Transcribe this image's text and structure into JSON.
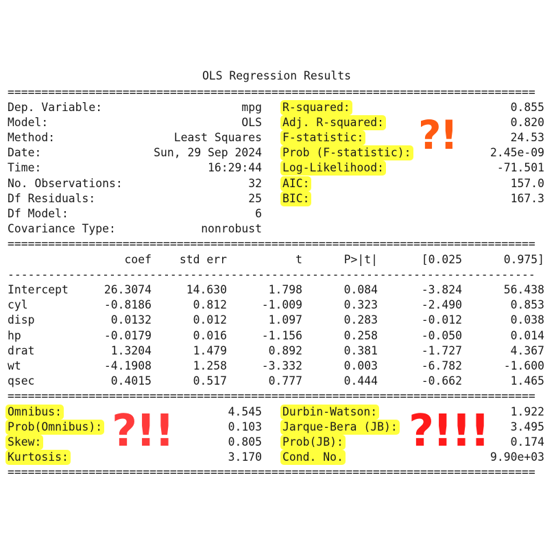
{
  "title": "OLS Regression Results",
  "separators": {
    "double": "==============================================================================",
    "single": "------------------------------------------------------------------------------"
  },
  "summary": {
    "left": [
      {
        "label": "Dep. Variable:",
        "value": "mpg"
      },
      {
        "label": "Model:",
        "value": "OLS"
      },
      {
        "label": "Method:",
        "value": "Least Squares"
      },
      {
        "label": "Date:",
        "value": "Sun, 29 Sep 2024"
      },
      {
        "label": "Time:",
        "value": "16:29:44"
      },
      {
        "label": "No. Observations:",
        "value": "32"
      },
      {
        "label": "Df Residuals:",
        "value": "25"
      },
      {
        "label": "Df Model:",
        "value": "6"
      },
      {
        "label": "Covariance Type:",
        "value": "nonrobust"
      }
    ],
    "right": [
      {
        "label": "R-squared:",
        "value": "0.855"
      },
      {
        "label": "Adj. R-squared:",
        "value": "0.820"
      },
      {
        "label": "F-statistic:",
        "value": "24.53"
      },
      {
        "label": "Prob (F-statistic):",
        "value": "2.45e-09"
      },
      {
        "label": "Log-Likelihood:",
        "value": "-71.501"
      },
      {
        "label": "AIC:",
        "value": "157.0"
      },
      {
        "label": "BIC:",
        "value": "167.3"
      }
    ]
  },
  "coef_table": {
    "headers": [
      "coef",
      "std err",
      "t",
      "P>|t|",
      "[0.025",
      "0.975]"
    ],
    "rows": [
      {
        "name": "Intercept",
        "values": [
          "26.3074",
          "14.630",
          "1.798",
          "0.084",
          "-3.824",
          "56.438"
        ]
      },
      {
        "name": "cyl",
        "values": [
          "-0.8186",
          "0.812",
          "-1.009",
          "0.323",
          "-2.490",
          "0.853"
        ]
      },
      {
        "name": "disp",
        "values": [
          "0.0132",
          "0.012",
          "1.097",
          "0.283",
          "-0.012",
          "0.038"
        ]
      },
      {
        "name": "hp",
        "values": [
          "-0.0179",
          "0.016",
          "-1.156",
          "0.258",
          "-0.050",
          "0.014"
        ]
      },
      {
        "name": "drat",
        "values": [
          "1.3204",
          "1.479",
          "0.892",
          "0.381",
          "-1.727",
          "4.367"
        ]
      },
      {
        "name": "wt",
        "values": [
          "-4.1908",
          "1.258",
          "-3.332",
          "0.003",
          "-6.782",
          "-1.600"
        ]
      },
      {
        "name": "qsec",
        "values": [
          "0.4015",
          "0.517",
          "0.777",
          "0.444",
          "-0.662",
          "1.465"
        ]
      }
    ]
  },
  "diagnostics": {
    "left": [
      {
        "label": "Omnibus:",
        "value": "4.545"
      },
      {
        "label": "Prob(Omnibus):",
        "value": "0.103"
      },
      {
        "label": "Skew:",
        "value": "0.805"
      },
      {
        "label": "Kurtosis:",
        "value": "3.170"
      }
    ],
    "right": [
      {
        "label": "Durbin-Watson:",
        "value": "1.922"
      },
      {
        "label": "Jarque-Bera (JB):",
        "value": "3.495"
      },
      {
        "label": "Prob(JB):",
        "value": "0.174"
      },
      {
        "label": "Cond. No.",
        "value": "9.90e+03"
      }
    ]
  },
  "annotations": {
    "mark_1": "?!",
    "mark_2": "?!!",
    "mark_3": "?!!!",
    "highlight_color": "#ffff3d",
    "mark_color": "#ff3b1a"
  }
}
